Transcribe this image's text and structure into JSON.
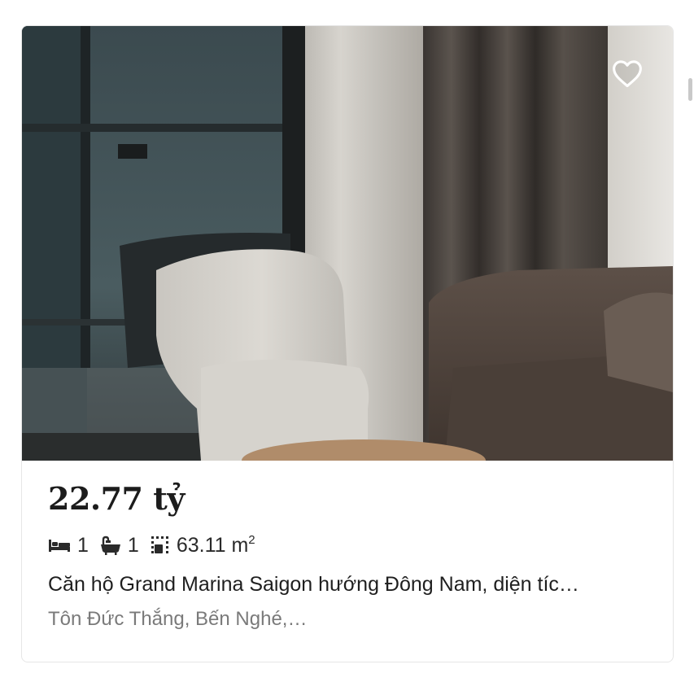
{
  "listing": {
    "price": "22.77 tỷ",
    "bedrooms": "1",
    "bathrooms": "1",
    "area": "63.11 m",
    "area_unit_sup": "2",
    "title": "Căn hộ Grand Marina Saigon hướng Đông Nam, diện tíc…",
    "address": "Tôn Đức Thắng,  Bến Nghé,…"
  },
  "icons": {
    "favorite": "heart-outline-icon",
    "bed": "bed-icon",
    "bath": "bathtub-icon",
    "area": "area-icon"
  }
}
